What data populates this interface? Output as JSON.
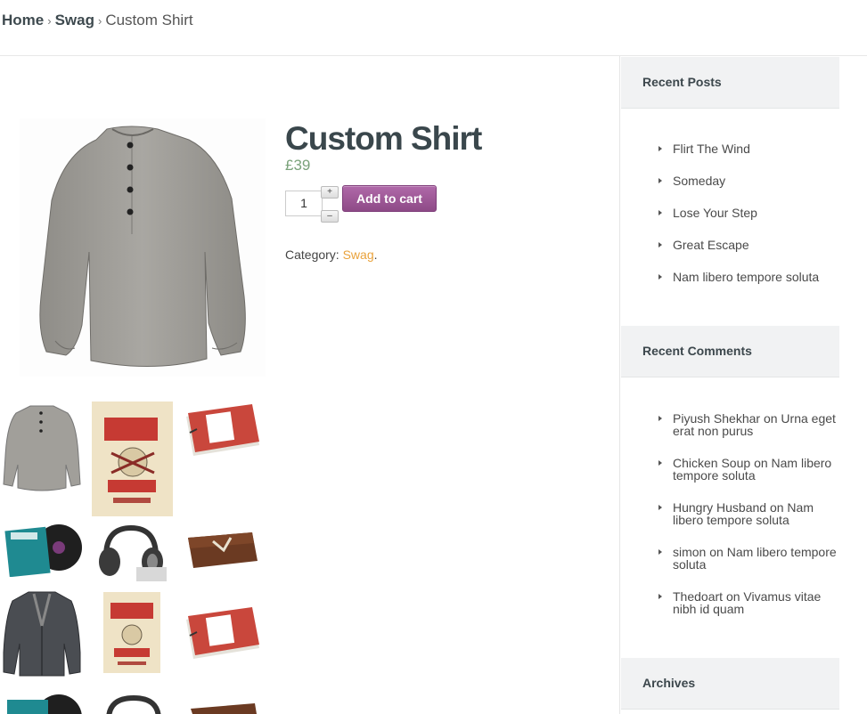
{
  "breadcrumb": {
    "home": "Home",
    "swag": "Swag",
    "separator": "›",
    "current": "Custom Shirt"
  },
  "product": {
    "title": "Custom Shirt",
    "price": "£39",
    "quantity": "1",
    "plus_label": "+",
    "minus_label": "–",
    "add_to_cart": "Add to cart",
    "category_label": "Category:",
    "category_value": "Swag",
    "category_end": "."
  },
  "thumbnails": [
    "shirt",
    "rock-festival-poster",
    "photo-album",
    "vinyl-records",
    "headphones",
    "leather-wallet",
    "jacket",
    "rock-festival-poster",
    "photo-album",
    "vinyl-records",
    "headphones",
    "leather-wallet"
  ],
  "sidebar": {
    "recent_posts": {
      "title": "Recent Posts",
      "items": [
        "Flirt The Wind",
        "Someday",
        "Lose Your Step",
        "Great Escape",
        "Nam libero tempore soluta"
      ]
    },
    "recent_comments": {
      "title": "Recent Comments",
      "items": [
        {
          "author": "Piyush Shekhar",
          "on": "on",
          "post": "Urna eget erat non purus"
        },
        {
          "author": "Chicken Soup",
          "on": "on",
          "post": "Nam libero tempore soluta"
        },
        {
          "author": "Hungry Husband",
          "on": "on",
          "post": "Nam libero tempore soluta"
        },
        {
          "author": "simon",
          "on": "on",
          "post": "Nam libero tempore soluta"
        },
        {
          "author": "Thedoart",
          "on": "on",
          "post": "Vivamus vitae nibh id quam"
        }
      ]
    },
    "archives": {
      "title": "Archives"
    }
  },
  "colors": {
    "accent_purple": "#9b5695",
    "price_green": "#7aa27a",
    "link_orange": "#e9a23b",
    "heading": "#3a474c"
  }
}
